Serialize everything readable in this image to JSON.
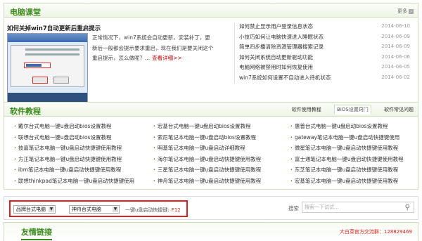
{
  "pc_class": {
    "title": "电脑课堂",
    "more": "更多",
    "article_title": "如何关掉win7自动更新后重启提示",
    "article_text": "正常情况下，win7系统会自动更新，安装补丁，更新后一般都会提示要求重启，现在我们是要关闭这个重启提示，怎么做呢？...",
    "detail_link": "查看详细>>",
    "news": [
      {
        "title": "如何禁止显示用户登录信息状态",
        "date": "2014-06-10"
      },
      {
        "title": "小技巧如何让电脑快速进入睡眠状态",
        "date": "2014-06-09"
      },
      {
        "title": "简单四步播清除资源管理器搜索记录",
        "date": "2014-06-09"
      },
      {
        "title": "如何关闭系统自动更新驱动功能",
        "date": "2014-06-06"
      },
      {
        "title": "电脑网络被禁用时如何恢复使用",
        "date": "2014-06-05"
      },
      {
        "title": "win7系统如何设置不自动进入待机状态",
        "date": "2014-06-02"
      }
    ]
  },
  "software": {
    "title": "软件教程",
    "tabs": [
      "软件使用教程",
      "BIOS设置窍门",
      "软件常见问题"
    ],
    "col1": [
      "戴尔台式电脑一键u盘启动bios设置教程",
      "联想台式电脑一键u盘启动bios设置教程",
      "技嘉笔记本电脑一键u盘启动快捷键使用教程",
      "方正笔记本电脑一键u盘启动快捷键使用教程",
      "ibm笔记本电脑一键u盘启动快捷键使用教程",
      "联想thinkpad笔记本电脑一键u盘启动快捷键使用"
    ],
    "col2": [
      "宏基台式电脑一键u盘启动bios设置教程",
      "索尼笔记本电脑一键u盘启动bios设置教程",
      "明基笔记本电脑一键u盘启动详细教程",
      "海尔笔记本电脑一键u盘启动快捷键使用教程",
      "三星笔记本电脑一键u盘启动快捷键使用教程",
      "神舟笔记本电脑一键u盘启动快捷键使用教程"
    ],
    "col3": [
      "惠普台式电脑一键u盘启动bios设置教程",
      "gateway笔记本电脑一键u盘启动快捷键使用",
      "微星笔记本电脑一键u盘启动快捷键使用教程",
      "富士通笔记本电脑一键u盘启动快捷键使用教程",
      "东芝笔记本电脑一键u盘启动快捷键使用教程",
      "宏基笔记本电脑一键u盘启动快捷键使用教程"
    ]
  },
  "search_row": {
    "brand_select": "品牌台式电脑",
    "model_select": "神舟台式电脑",
    "hotkey_label": "一键u盘启动快捷键:",
    "hotkey_value": "F12",
    "search_label": "搜索",
    "search_placeholder": "搜索一下试试..."
  },
  "links": {
    "title": "友情链接",
    "qq_group": "大白菜官方交流群：128829469"
  }
}
